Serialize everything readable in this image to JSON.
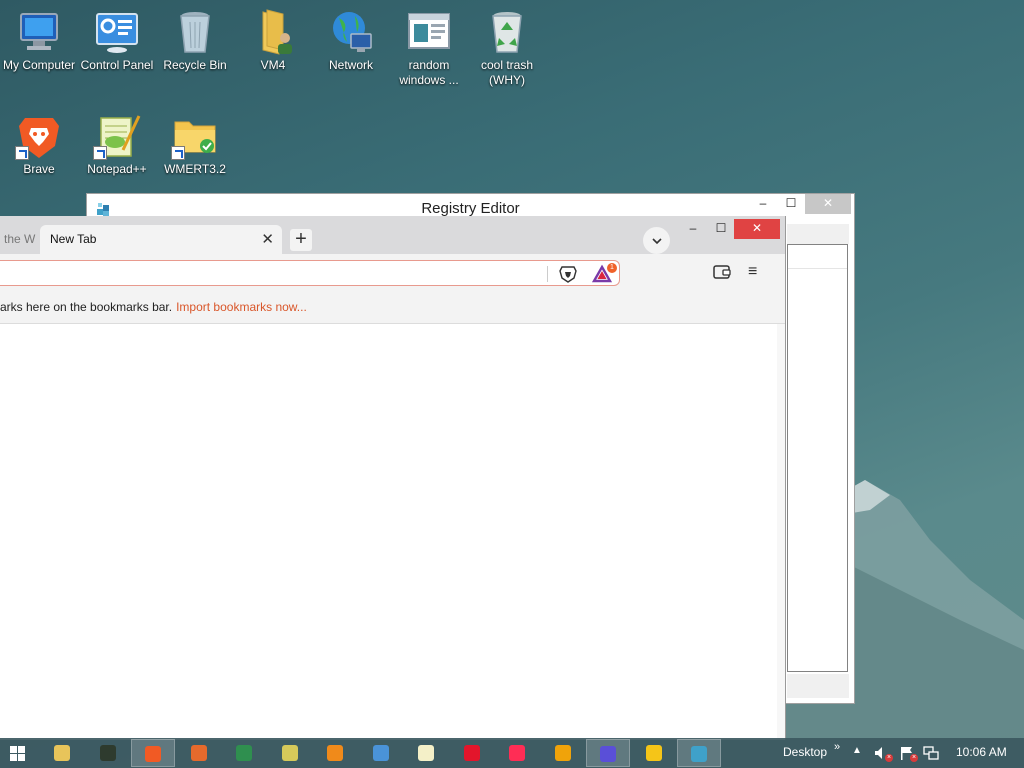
{
  "desktop": {
    "icons_row1": [
      {
        "label": "My Computer",
        "icon": "computer-icon"
      },
      {
        "label": "Control Panel",
        "icon": "control-panel-icon"
      },
      {
        "label": "Recycle Bin",
        "icon": "recycle-bin-icon"
      },
      {
        "label": "VM4",
        "icon": "user-folder-icon"
      },
      {
        "label": "Network",
        "icon": "network-icon"
      },
      {
        "label": "random\nwindows ...",
        "icon": "window-app-icon"
      },
      {
        "label": "cool trash\n(WHY)",
        "icon": "full-recycle-bin-icon"
      }
    ],
    "icons_row2": [
      {
        "label": "Brave",
        "icon": "brave-icon"
      },
      {
        "label": "Notepad++",
        "icon": "notepadpp-icon"
      },
      {
        "label": "WMERT3.2",
        "icon": "folder-icon"
      }
    ]
  },
  "regedit": {
    "title": "Registry Editor",
    "minimize": "–",
    "maximize": "☐",
    "close": "✕"
  },
  "browser": {
    "prev_tab_title": "the W",
    "active_tab_title": "New Tab",
    "tab_close": "✕",
    "new_tab": "+",
    "tab_search": "⌄",
    "minimize": "–",
    "maximize": "☐",
    "close": "✕",
    "omnibox_value": "",
    "rewards_badge": "1",
    "menu": "≡",
    "bookmarks_text": "arks here on the bookmarks bar.",
    "bookmarks_link": "Import bookmarks now..."
  },
  "taskbar": {
    "tray_label": "Desktop",
    "tray_chevron": "»",
    "tray_up": "▲",
    "clock": "10:06 AM",
    "apps": [
      {
        "name": "file-explorer",
        "color": "#e8c45a"
      },
      {
        "name": "terminal",
        "color": "#2e3b2e"
      },
      {
        "name": "brave",
        "color": "#f15a24"
      },
      {
        "name": "firefox",
        "color": "#e66a2c"
      },
      {
        "name": "network-globe",
        "color": "#2f8f4f"
      },
      {
        "name": "media-disc",
        "color": "#d6c95a"
      },
      {
        "name": "vlc",
        "color": "#f08a1a"
      },
      {
        "name": "control-panel",
        "color": "#4a93d8"
      },
      {
        "name": "notepad",
        "color": "#f4f0c8"
      },
      {
        "name": "opera",
        "color": "#e3152b"
      },
      {
        "name": "opera-gx",
        "color": "#ff2d55"
      },
      {
        "name": "media-player",
        "color": "#f0a30a"
      },
      {
        "name": "settings",
        "color": "#5a4fd8"
      },
      {
        "name": "chrome",
        "color": "#f5c518"
      },
      {
        "name": "regedit",
        "color": "#3fa1c9"
      }
    ]
  }
}
